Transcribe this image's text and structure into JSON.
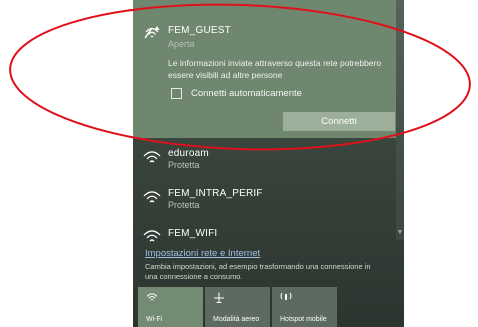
{
  "selected_network": {
    "name": "FEM_GUEST",
    "status": "Aperta",
    "warning": "Le informazioni inviate attraverso questa rete potrebbero essere visibili ad altre persone",
    "auto_connect_label": "Connetti automaticamente",
    "auto_connect_checked": false,
    "connect_label": "Connetti"
  },
  "networks": [
    {
      "name": "eduroam",
      "status": "Protetta"
    },
    {
      "name": "FEM_INTRA_PERIF",
      "status": "Protetta"
    },
    {
      "name": "FEM_WIFI",
      "status": ""
    }
  ],
  "settings": {
    "link": "Impostazioni rete e Internet",
    "description": "Cambia impostazioni, ad esempio trasformando una connessione in una connessione a consumo."
  },
  "quick_actions": [
    {
      "label": "Wi-Fi",
      "icon": "wifi-icon",
      "active": true
    },
    {
      "label": "Modalità aereo",
      "icon": "airplane-icon",
      "active": false
    },
    {
      "label": "Hotspot mobile",
      "icon": "hotspot-icon",
      "active": false
    }
  ],
  "colors": {
    "panel": "#39443c",
    "selected": "#70876f",
    "accent_link": "#9fc0e6",
    "annotation": "#e0101a"
  }
}
